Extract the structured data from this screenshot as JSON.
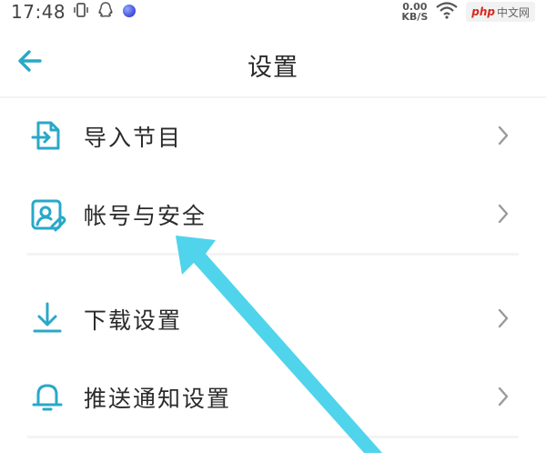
{
  "status_bar": {
    "time": "17:48",
    "net_speed_value": "0.00",
    "net_speed_unit": "KB/S",
    "watermark_php": "php",
    "watermark_text": "中文网"
  },
  "header": {
    "title": "设置"
  },
  "settings": {
    "items": [
      {
        "label": "导入节目",
        "icon": "import-icon"
      },
      {
        "label": "帐号与安全",
        "icon": "account-security-icon"
      },
      {
        "label": "下载设置",
        "icon": "download-icon"
      },
      {
        "label": "推送通知设置",
        "icon": "bell-icon"
      }
    ]
  },
  "colors": {
    "accent": "#29a8c8",
    "annotation_arrow": "#4fd4ec",
    "chevron": "#9a9a9a"
  }
}
